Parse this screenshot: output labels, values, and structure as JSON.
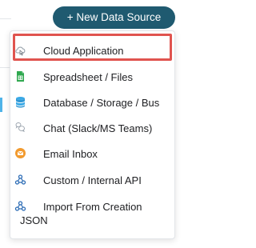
{
  "header": {
    "new_source_button": "+ New Data Source"
  },
  "menu": {
    "items": [
      {
        "label": "Cloud Application",
        "icon": "cloud-icon"
      },
      {
        "label": "Spreadsheet / Files",
        "icon": "spreadsheet-icon"
      },
      {
        "label": "Database / Storage / Bus",
        "icon": "database-icon"
      },
      {
        "label": "Chat (Slack/MS Teams)",
        "icon": "chat-icon"
      },
      {
        "label": "Email Inbox",
        "icon": "email-icon"
      },
      {
        "label": "Custom / Internal API",
        "icon": "webhook-icon"
      },
      {
        "label": "Import From Creation",
        "label_line2": "JSON",
        "icon": "webhook-icon"
      }
    ],
    "highlighted_item": "Cloud Application"
  },
  "colors": {
    "button_bg": "#1f5a70",
    "highlight_border": "#e0544f",
    "spreadsheet_green": "#2fa84f",
    "database_blue": "#3aa9e6",
    "email_orange": "#f29a2e",
    "webhook_blue": "#2b6bb5"
  }
}
